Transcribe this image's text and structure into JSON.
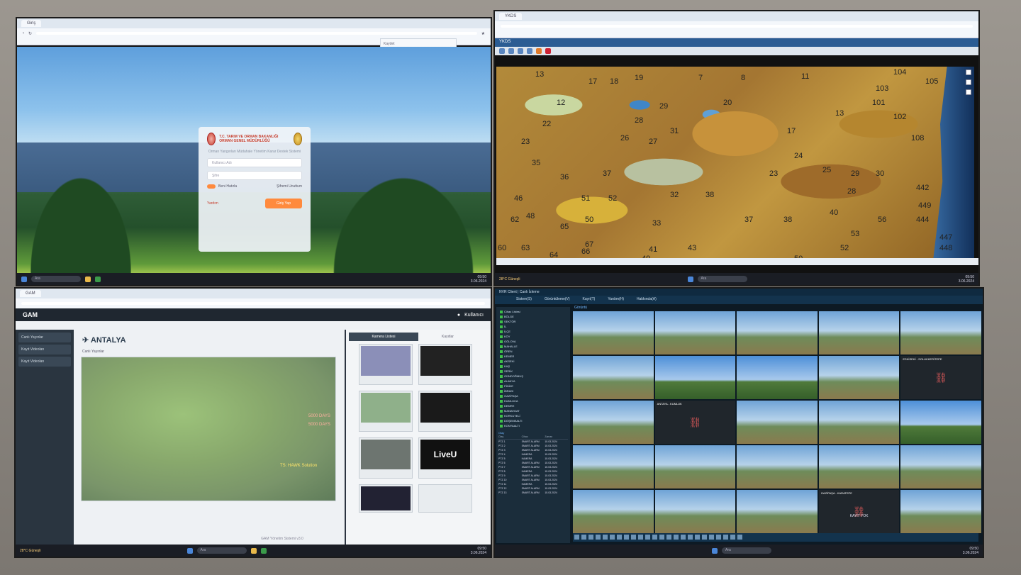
{
  "screen1": {
    "tab_title": "Giriş",
    "popup_title": "Kaydet",
    "login": {
      "institution": "T.C. TARIM VE ORMAN BAKANLIĞI ORMAN GENEL MÜDÜRLÜĞÜ",
      "subtitle": "Orman Yangınları Müdahale Yönetim Karar Destek Sistemi",
      "username_placeholder": "Kullanıcı Adı",
      "password_placeholder": "Şifre",
      "remember_label": "Beni Hatırla",
      "forgot_label": "Şifremi Unuttum",
      "help_label": "Yardım",
      "submit_label": "Giriş Yap"
    }
  },
  "screen2": {
    "window_title": "YKDS",
    "map_labels": [
      {
        "t": "13"
      },
      {
        "t": "17"
      },
      {
        "t": "18"
      },
      {
        "t": "19"
      },
      {
        "t": "7"
      },
      {
        "t": "8"
      },
      {
        "t": "11"
      },
      {
        "t": "104"
      },
      {
        "t": "103"
      },
      {
        "t": "105"
      },
      {
        "t": "12"
      },
      {
        "t": "29"
      },
      {
        "t": "20"
      },
      {
        "t": "101"
      },
      {
        "t": "102"
      },
      {
        "t": "22"
      },
      {
        "t": "28"
      },
      {
        "t": "31"
      },
      {
        "t": "17"
      },
      {
        "t": "13"
      },
      {
        "t": "108"
      },
      {
        "t": "23"
      },
      {
        "t": "27"
      },
      {
        "t": "26"
      },
      {
        "t": "24"
      },
      {
        "t": "35"
      },
      {
        "t": "36"
      },
      {
        "t": "37"
      },
      {
        "t": "32"
      },
      {
        "t": "23"
      },
      {
        "t": "25"
      },
      {
        "t": "29"
      },
      {
        "t": "30"
      },
      {
        "t": "46"
      },
      {
        "t": "51"
      },
      {
        "t": "52"
      },
      {
        "t": "38"
      },
      {
        "t": "28"
      },
      {
        "t": "442"
      },
      {
        "t": "62"
      },
      {
        "t": "48"
      },
      {
        "t": "50"
      },
      {
        "t": "33"
      },
      {
        "t": "37"
      },
      {
        "t": "38"
      },
      {
        "t": "40"
      },
      {
        "t": "53"
      },
      {
        "t": "56"
      },
      {
        "t": "444"
      },
      {
        "t": "449"
      },
      {
        "t": "65"
      },
      {
        "t": "67"
      },
      {
        "t": "41"
      },
      {
        "t": "43"
      },
      {
        "t": "52"
      },
      {
        "t": "447"
      },
      {
        "t": "60"
      },
      {
        "t": "63"
      },
      {
        "t": "64"
      },
      {
        "t": "66"
      },
      {
        "t": "49"
      },
      {
        "t": "50"
      },
      {
        "t": "448"
      }
    ]
  },
  "screen3": {
    "brand": "GAM",
    "user": "Kullanıcı",
    "sidebar": [
      "Canlı Yayınlar",
      "Kayıt Videoları",
      "Kayıt Videoları"
    ],
    "title": "ANTALYA",
    "subtitle": "Canlı Yayınlar",
    "cam_tab": "Kamera Listesi",
    "cam_tab2": "Kayıtlar",
    "overlay": [
      "TS: HAWK Solution",
      "5000 DAYS",
      "5000 DAYS"
    ],
    "liveu": "LiveU",
    "footer": "GAM Yönetim Sistemi v3.0"
  },
  "screen4": {
    "title": "NVR Client | Canlı İzleme",
    "menu": [
      "Sistem(S)",
      "Görüntüleme(V)",
      "Kayıt(T)",
      "Yardım(H)",
      "Hakkında(A)"
    ],
    "view_label": "Görüntü",
    "tree": [
      "Cihaz Listesi",
      "BÖLGE",
      "SEKTÖR",
      "İL",
      "İLÇE",
      "KÖY",
      "GÖLOVA",
      "MAHALLE",
      "ÖREN",
      "KEMER",
      "AKSEKİ",
      "KAŞ",
      "SERİK",
      "GÜNDOĞMUŞ",
      "ALANYA",
      "FİNİKE",
      "İBRADI",
      "GAZİPAŞA",
      "KUMLUCA",
      "DEMRE",
      "MANAVGAT",
      "KORKUTELİ",
      "DÖŞEMEALTI",
      "KONYAALTI"
    ],
    "events_label": "Olay",
    "events_cols": [
      "Olay",
      "Cihaz",
      "Zaman"
    ],
    "events": [
      [
        "PTZ 1",
        "SMART ALARM",
        "15.03.2024"
      ],
      [
        "PTZ 2",
        "SMART ALARM",
        "15.03.2024"
      ],
      [
        "PTZ 3",
        "SMART ALARM",
        "15.03.2024"
      ],
      [
        "PTZ 4",
        "KAMERA",
        "15.03.2024"
      ],
      [
        "PTZ 5",
        "KAMERA",
        "15.03.2024"
      ],
      [
        "PTZ 6",
        "SMART ALARM",
        "15.03.2024"
      ],
      [
        "PTZ 7",
        "SMART ALARM",
        "15.03.2024"
      ],
      [
        "PTZ 8",
        "KAMERA",
        "15.03.2024"
      ],
      [
        "PTZ 9",
        "SMART ALARM",
        "15.03.2024"
      ],
      [
        "PTZ 10",
        "SMART ALARM",
        "15.03.2024"
      ],
      [
        "PTZ 11",
        "KAMERA",
        "15.03.2024"
      ],
      [
        "PTZ 12",
        "SMART ALARM",
        "15.03.2024"
      ],
      [
        "PTZ 13",
        "SMART ALARM",
        "15.03.2024"
      ]
    ],
    "cells": [
      {
        "label": "",
        "state": "on"
      },
      {
        "label": "",
        "state": "on"
      },
      {
        "label": "",
        "state": "on"
      },
      {
        "label": "",
        "state": "on"
      },
      {
        "label": "",
        "state": "on"
      },
      {
        "label": "",
        "state": "on"
      },
      {
        "label": "",
        "state": "blue"
      },
      {
        "label": "",
        "state": "blue"
      },
      {
        "label": "",
        "state": "on"
      },
      {
        "label": "ESKİSEKİ - SOLUKKERİTEPE",
        "state": "off"
      },
      {
        "label": "",
        "state": "on"
      },
      {
        "label": "ANTAYA - KUMLUK",
        "state": "off"
      },
      {
        "label": "",
        "state": "on"
      },
      {
        "label": "",
        "state": "on"
      },
      {
        "label": "",
        "state": "blue"
      },
      {
        "label": "",
        "state": "on"
      },
      {
        "label": "",
        "state": "on"
      },
      {
        "label": "",
        "state": "on"
      },
      {
        "label": "",
        "state": "on"
      },
      {
        "label": "",
        "state": "on"
      },
      {
        "label": "",
        "state": "on"
      },
      {
        "label": "",
        "state": "on"
      },
      {
        "label": "",
        "state": "on"
      },
      {
        "label": "GAZİPAŞA - KARATEPE",
        "state": "off"
      },
      {
        "label": "",
        "state": "on"
      }
    ],
    "nosignal": "KAYIT YOK"
  },
  "taskbars": {
    "search": "Ara",
    "weather": "28°C Güneşli",
    "clock": "09:50",
    "date": "3.06.2024"
  }
}
